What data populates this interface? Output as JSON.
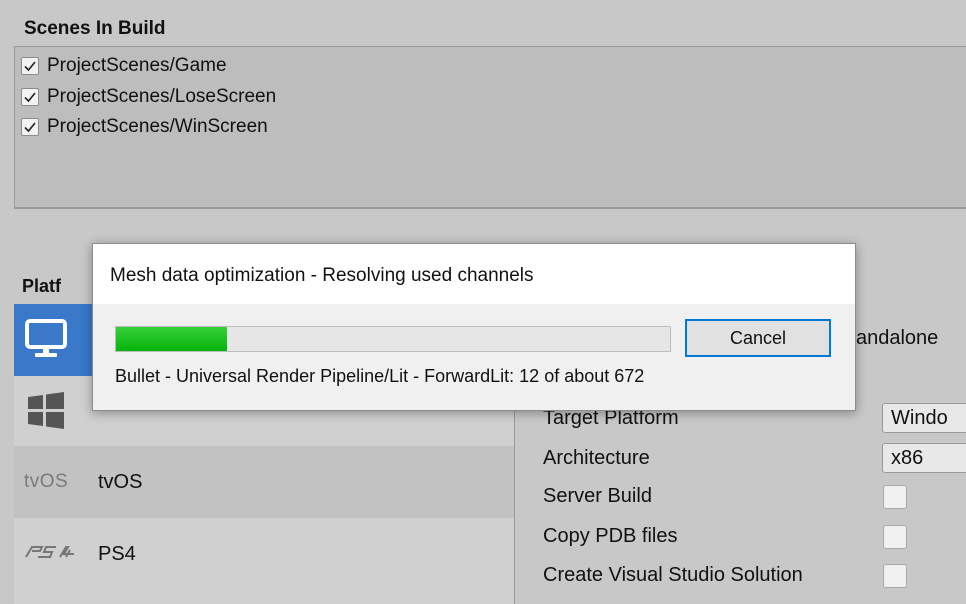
{
  "scenes": {
    "header": "Scenes In Build",
    "items": [
      {
        "label": "ProjectScenes/Game",
        "checked": true
      },
      {
        "label": "ProjectScenes/LoseScreen",
        "checked": true
      },
      {
        "label": "ProjectScenes/WinScreen",
        "checked": true
      }
    ]
  },
  "platform": {
    "header": "Platf",
    "items": [
      {
        "icon": "monitor-icon",
        "label": "",
        "selected": true
      },
      {
        "icon": "windows-icon",
        "label": ""
      },
      {
        "icon": "tvos-logo",
        "logo_text": "tvOS",
        "label": "tvOS"
      },
      {
        "icon": "ps4-logo",
        "logo_text": "PS4",
        "label": "PS4"
      }
    ],
    "selected_title": "andalone"
  },
  "settings": {
    "target_platform": {
      "label": "Target Platform",
      "value": "Windo"
    },
    "architecture": {
      "label": "Architecture",
      "value": "x86"
    },
    "server_build": {
      "label": "Server Build",
      "checked": false
    },
    "copy_pdb": {
      "label": "Copy PDB files",
      "checked": false
    },
    "create_vs_solution": {
      "label": "Create Visual Studio Solution",
      "checked": false
    }
  },
  "dialog": {
    "title": "Mesh data optimization - Resolving used channels",
    "progress_fraction": 0.2,
    "cancel_label": "Cancel",
    "status": "Bullet - Universal Render Pipeline/Lit - ForwardLit: 12 of about 672"
  },
  "colors": {
    "accent": "#0078d7",
    "progress": "#06b025",
    "selection": "#3a78c9"
  }
}
